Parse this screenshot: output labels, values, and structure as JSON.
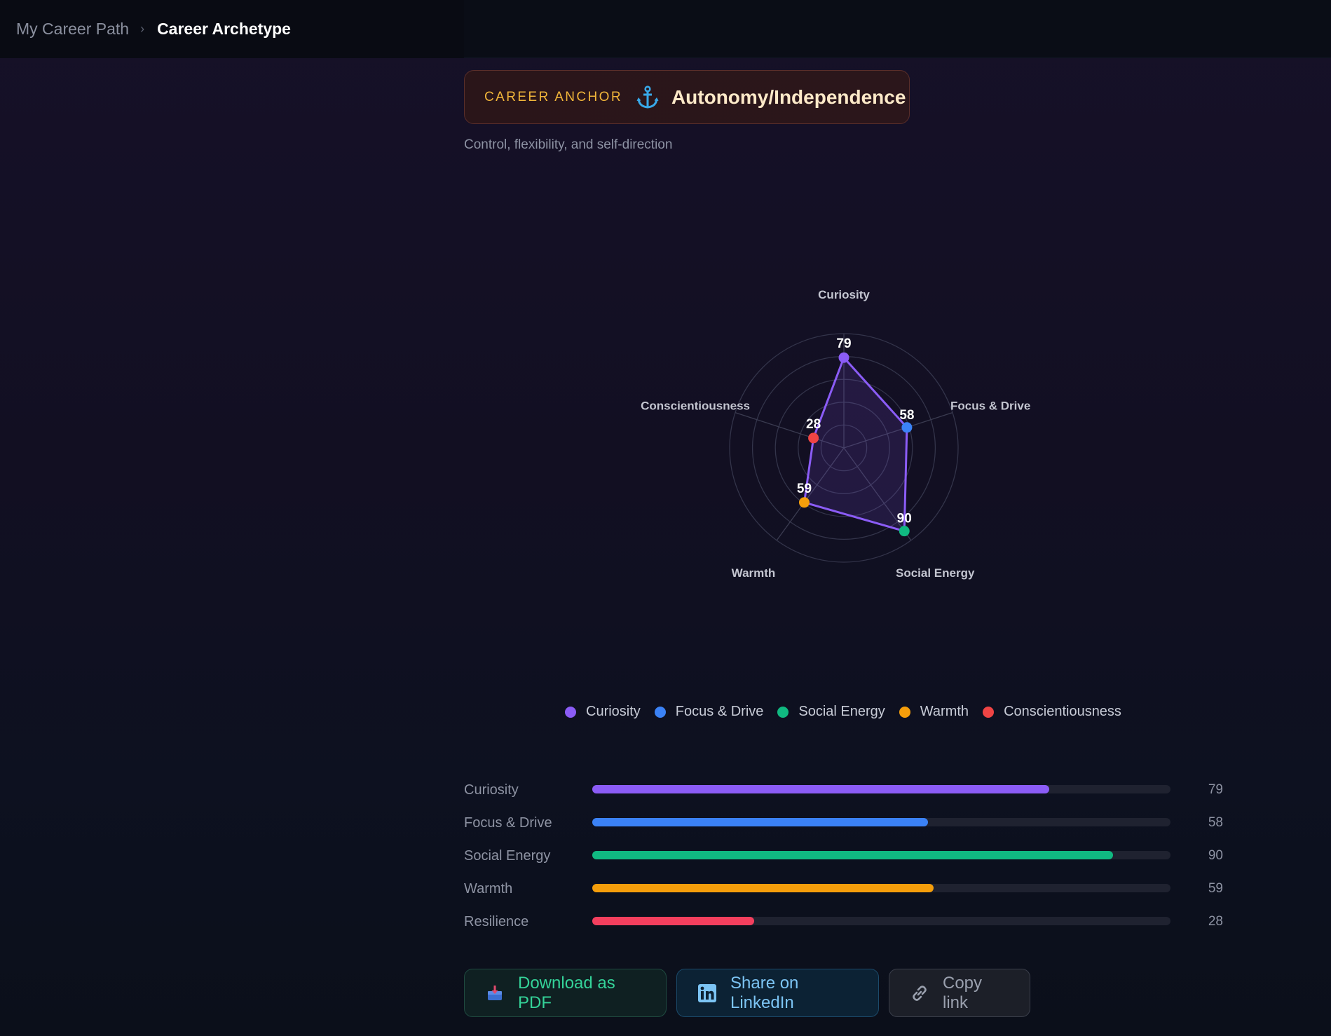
{
  "breadcrumb": {
    "root": "My Career Path",
    "separator": "›",
    "current": "Career Archetype"
  },
  "career_anchor": {
    "label": "CAREER ANCHOR",
    "icon": "anchor-icon",
    "value": "Autonomy/Independence",
    "description": "Control, flexibility, and self-direction"
  },
  "chart_data": {
    "type": "radar",
    "axes": [
      "Curiosity",
      "Focus & Drive",
      "Social Energy",
      "Warmth",
      "Conscientiousness"
    ],
    "values": [
      79,
      58,
      90,
      59,
      28
    ],
    "point_colors": [
      "#8b5cf6",
      "#3b82f6",
      "#10b981",
      "#f59e0b",
      "#ef4444"
    ],
    "range": [
      0,
      100
    ],
    "rings": 5,
    "line_color": "#8b5cf6",
    "legend": [
      {
        "name": "Curiosity",
        "color": "#8b5cf6"
      },
      {
        "name": "Focus & Drive",
        "color": "#3b82f6"
      },
      {
        "name": "Social Energy",
        "color": "#10b981"
      },
      {
        "name": "Warmth",
        "color": "#f59e0b"
      },
      {
        "name": "Conscientiousness",
        "color": "#ef4444"
      }
    ]
  },
  "trait_bars": [
    {
      "label": "Curiosity",
      "value": 79,
      "color": "#8b5cf6"
    },
    {
      "label": "Focus & Drive",
      "value": 58,
      "color": "#3b82f6"
    },
    {
      "label": "Social Energy",
      "value": 90,
      "color": "#10b981"
    },
    {
      "label": "Warmth",
      "value": 59,
      "color": "#f59e0b"
    },
    {
      "label": "Resilience",
      "value": 28,
      "color": "#f43f5e"
    }
  ],
  "actions": {
    "download_label": "Download as PDF",
    "download_icon": "inbox-tray-icon",
    "linkedin_label": "Share on LinkedIn",
    "linkedin_icon": "linkedin-icon",
    "copy_label": "Copy link",
    "copy_icon": "link-icon"
  }
}
